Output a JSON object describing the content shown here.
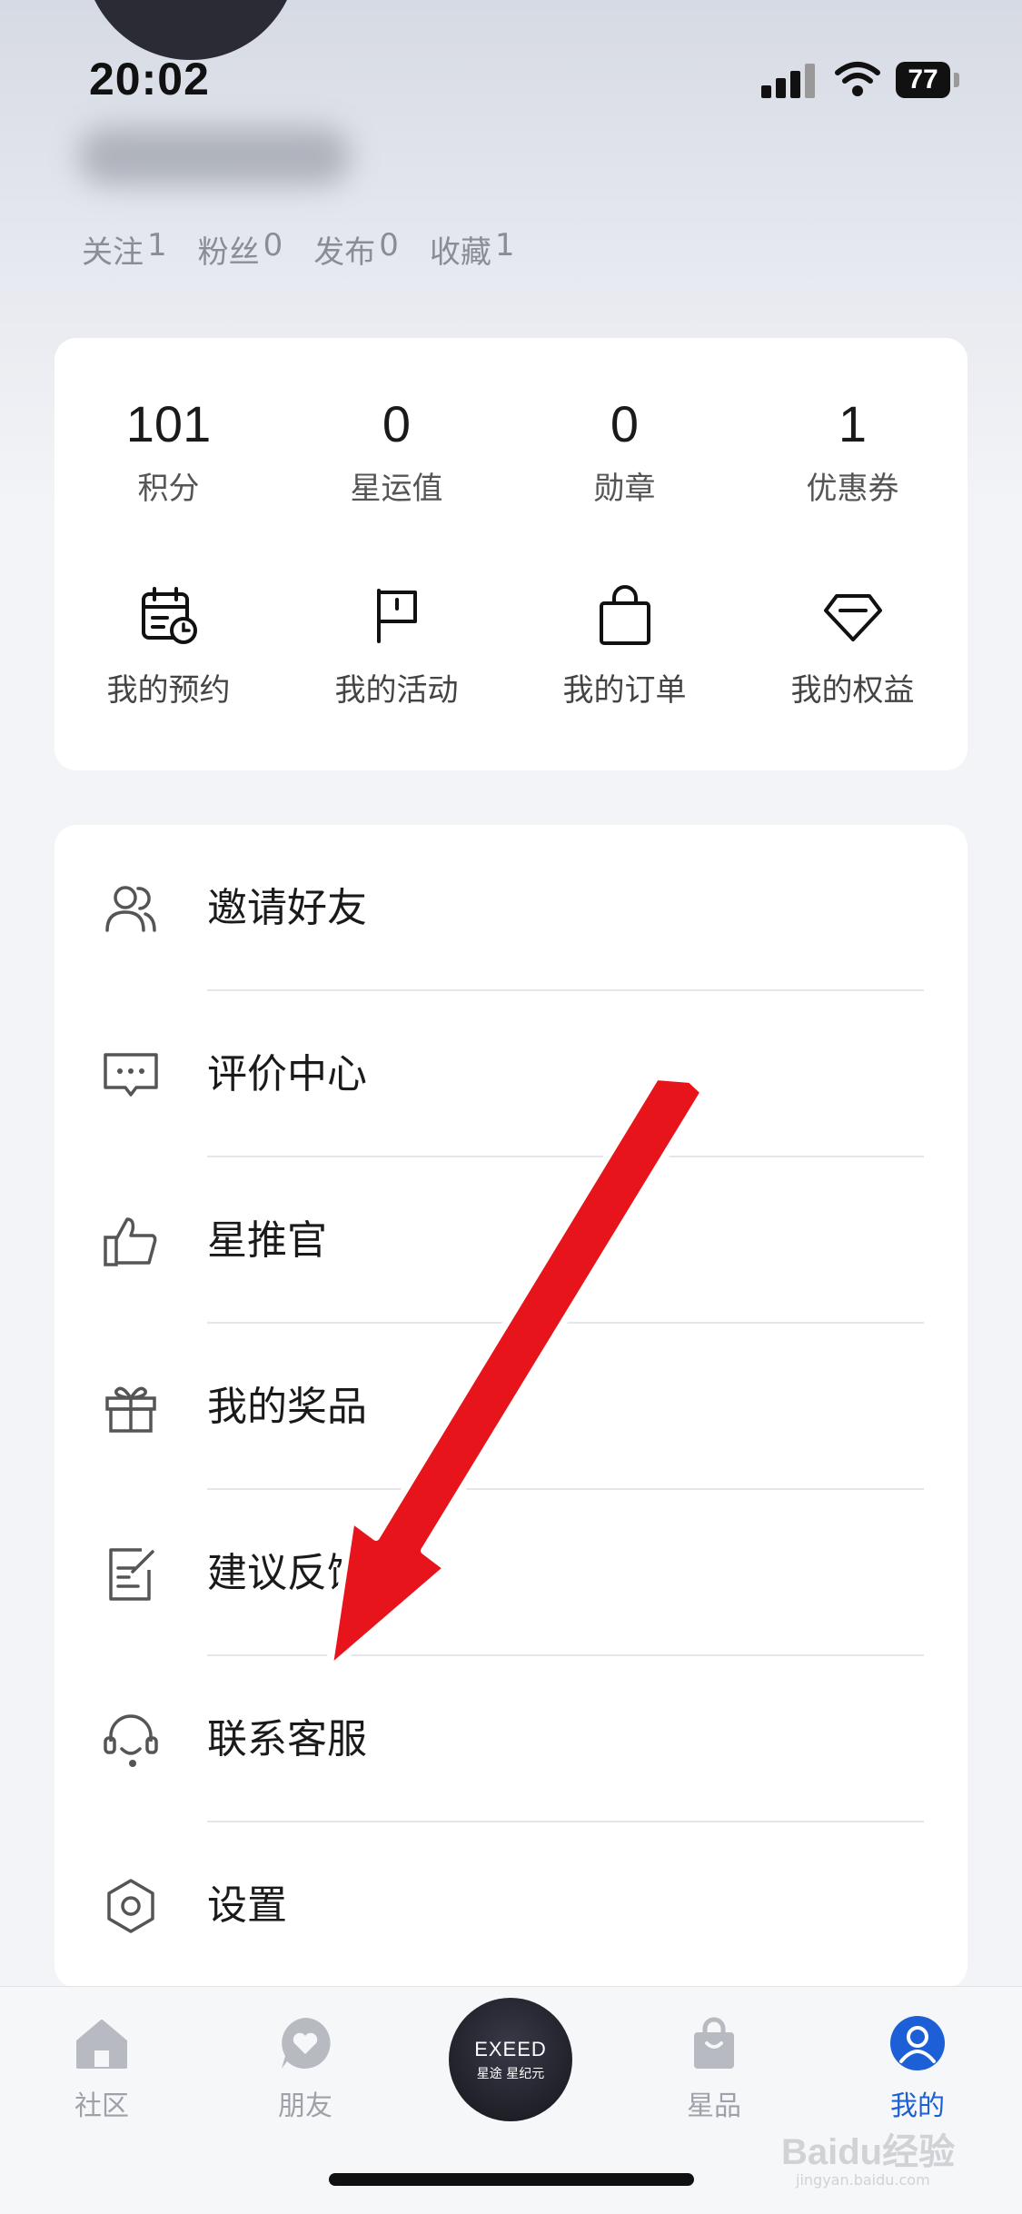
{
  "status_bar": {
    "time": "20:02",
    "battery": "77"
  },
  "profile": {
    "stats": [
      {
        "label": "关注",
        "value": "1"
      },
      {
        "label": "粉丝",
        "value": "0"
      },
      {
        "label": "发布",
        "value": "0"
      },
      {
        "label": "收藏",
        "value": "1"
      }
    ]
  },
  "metrics": [
    {
      "value": "101",
      "label": "积分"
    },
    {
      "value": "0",
      "label": "星运值"
    },
    {
      "value": "0",
      "label": "勋章"
    },
    {
      "value": "1",
      "label": "优惠券"
    }
  ],
  "shortcuts": [
    {
      "label": "我的预约",
      "icon": "calendar-clock-icon"
    },
    {
      "label": "我的活动",
      "icon": "flag-icon"
    },
    {
      "label": "我的订单",
      "icon": "shopping-bag-icon"
    },
    {
      "label": "我的权益",
      "icon": "diamond-icon"
    }
  ],
  "menu": [
    {
      "label": "邀请好友",
      "icon": "users-icon"
    },
    {
      "label": "评价中心",
      "icon": "comment-icon"
    },
    {
      "label": "星推官",
      "icon": "thumbs-up-icon"
    },
    {
      "label": "我的奖品",
      "icon": "gift-icon"
    },
    {
      "label": "建议反馈",
      "icon": "edit-note-icon"
    },
    {
      "label": "联系客服",
      "icon": "headset-icon"
    },
    {
      "label": "设置",
      "icon": "settings-hexagon-icon"
    }
  ],
  "tabbar": {
    "tabs": [
      {
        "label": "社区",
        "icon": "home-icon"
      },
      {
        "label": "朋友",
        "icon": "heart-chat-icon"
      },
      {
        "label": "星品",
        "icon": "bag-icon"
      },
      {
        "label": "我的",
        "icon": "user-circle-icon"
      }
    ],
    "center": {
      "brand": "EXEED",
      "sub": "星途 星纪元"
    },
    "active_tab": "我的",
    "active_color": "#1c5fd6"
  },
  "watermark": {
    "text": "Baidu经验",
    "sub": "jingyan.baidu.com"
  },
  "annotation": {
    "color": "#e8141c"
  }
}
